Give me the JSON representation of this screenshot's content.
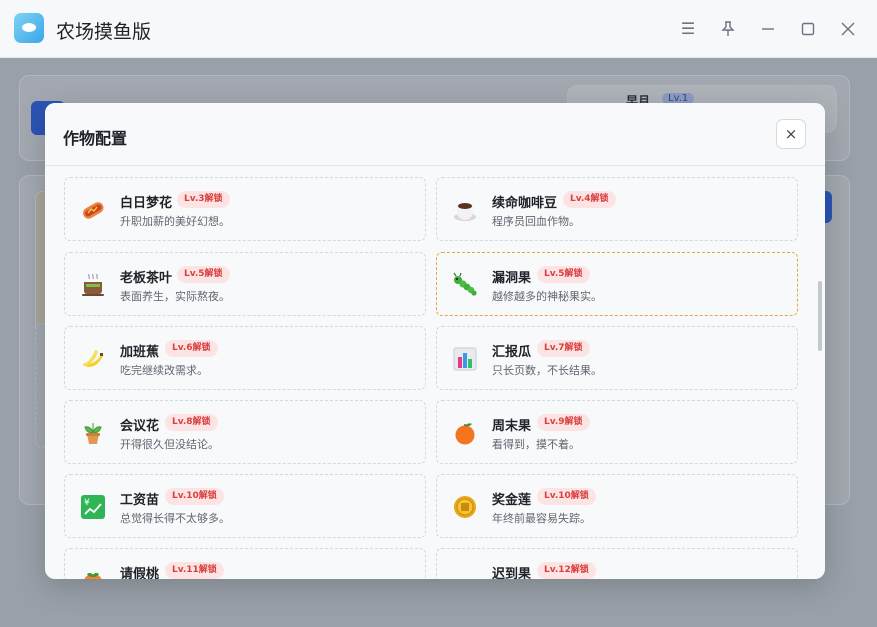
{
  "window": {
    "title": "农场摸鱼版",
    "controls": [
      "menu",
      "pin",
      "minimize",
      "maximize",
      "close"
    ]
  },
  "background": {
    "stage_label": "早月",
    "stage_level": "Lv.1"
  },
  "modal": {
    "title": "作物配置",
    "close_label": "×",
    "crops": [
      {
        "name": "白日梦花",
        "badge": "Lv.3解锁",
        "desc": "升职加薪的美好幻想。",
        "icon": "hotdog-icon",
        "highlight": false
      },
      {
        "name": "续命咖啡豆",
        "badge": "Lv.4解锁",
        "desc": "程序员回血作物。",
        "icon": "coffee-cup-icon",
        "highlight": false
      },
      {
        "name": "老板茶叶",
        "badge": "Lv.5解锁",
        "desc": "表面养生，实际熬夜。",
        "icon": "tea-cup-icon",
        "highlight": false
      },
      {
        "name": "漏洞果",
        "badge": "Lv.5解锁",
        "desc": "越修越多的神秘果实。",
        "icon": "bug-icon",
        "highlight": true
      },
      {
        "name": "加班蕉",
        "badge": "Lv.6解锁",
        "desc": "吃完继续改需求。",
        "icon": "banana-icon",
        "highlight": false
      },
      {
        "name": "汇报瓜",
        "badge": "Lv.7解锁",
        "desc": "只长页数，不长结果。",
        "icon": "bar-chart-icon",
        "highlight": false
      },
      {
        "name": "会议花",
        "badge": "Lv.8解锁",
        "desc": "开得很久但没结论。",
        "icon": "potted-plant-icon",
        "highlight": false
      },
      {
        "name": "周末果",
        "badge": "Lv.9解锁",
        "desc": "看得到，摸不着。",
        "icon": "orange-icon",
        "highlight": false
      },
      {
        "name": "工资苗",
        "badge": "Lv.10解锁",
        "desc": "总觉得长得不太够多。",
        "icon": "yen-chart-icon",
        "highlight": false
      },
      {
        "name": "奖金莲",
        "badge": "Lv.10解锁",
        "desc": "年终前最容易失踪。",
        "icon": "coin-icon",
        "highlight": false
      },
      {
        "name": "请假桃",
        "badge": "Lv.11解锁",
        "desc": "",
        "icon": "peach-icon",
        "highlight": false
      },
      {
        "name": "迟到果",
        "badge": "Lv.12解锁",
        "desc": "",
        "icon": "leaf-icon",
        "highlight": false
      }
    ]
  },
  "colors": {
    "badge_bg": "#fde4e4",
    "badge_text": "#d94040",
    "highlight_border": "#e8a247",
    "accent_blue": "#2b54b4"
  }
}
